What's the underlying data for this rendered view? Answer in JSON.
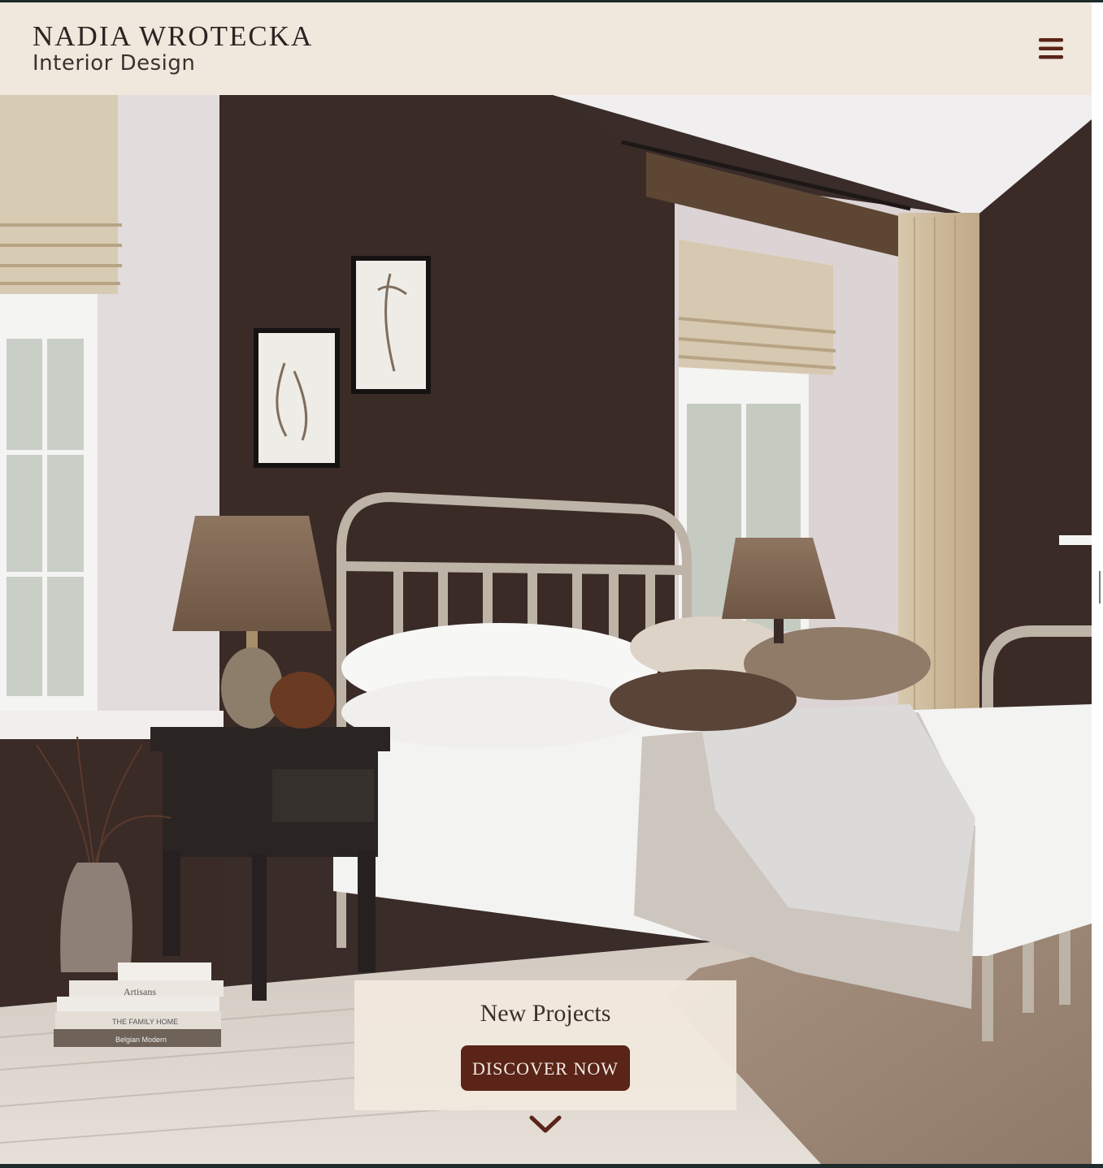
{
  "brand": {
    "name": "NADIA WROTECKA",
    "tagline": "Interior Design"
  },
  "nav": {
    "menu_icon": "hamburger-menu-icon"
  },
  "hero": {
    "image_description_icon": "bedroom-hero-image",
    "books": [
      "Artisans",
      "THE FAMILY HOME",
      "Belgian Modern"
    ]
  },
  "promo": {
    "title": "New Projects",
    "button_label": "DISCOVER NOW"
  },
  "scroll": {
    "icon": "chevron-down-icon"
  },
  "colors": {
    "header_bg": "#f0e7dd",
    "accent": "#5a2418",
    "wall_dark": "#3a2c28"
  }
}
